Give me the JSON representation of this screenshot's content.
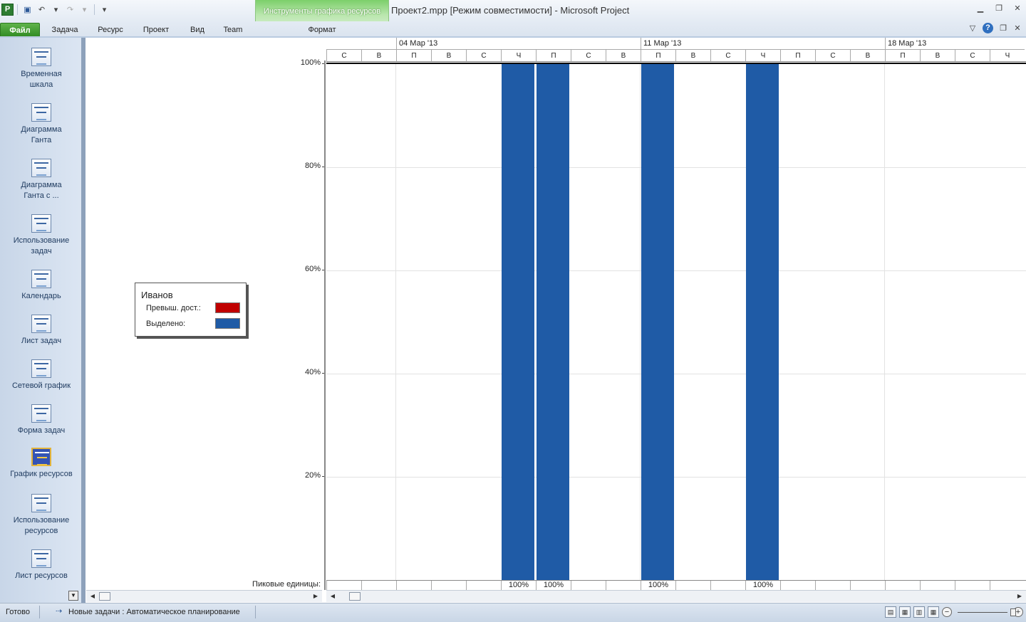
{
  "app": {
    "window_title": "Проект2.mpp [Режим совместимости]  -  Microsoft Project",
    "context_tab_group": "Инструменты графика ресурсов"
  },
  "ribbon": {
    "tabs": [
      {
        "label": "Файл",
        "active": true
      },
      {
        "label": "Задача"
      },
      {
        "label": "Ресурс"
      },
      {
        "label": "Проект"
      },
      {
        "label": "Вид"
      },
      {
        "label": "Team"
      },
      {
        "label": "Формат"
      }
    ]
  },
  "view_bar": {
    "items": [
      {
        "label": "Временная шкала",
        "icon": "timeline-icon"
      },
      {
        "label": "Диаграмма Ганта",
        "icon": "gantt-icon"
      },
      {
        "label": "Диаграмма Ганта с ...",
        "icon": "tracking-gantt-icon"
      },
      {
        "label": "Использование задач",
        "icon": "task-usage-icon"
      },
      {
        "label": "Календарь",
        "icon": "calendar-icon"
      },
      {
        "label": "Лист задач",
        "icon": "task-sheet-icon"
      },
      {
        "label": "Сетевой график",
        "icon": "network-icon"
      },
      {
        "label": "Форма задач",
        "icon": "task-form-icon"
      },
      {
        "label": "График ресурсов",
        "icon": "resource-graph-icon",
        "active": true
      },
      {
        "label": "Использование ресурсов",
        "icon": "resource-usage-icon"
      },
      {
        "label": "Лист ресурсов",
        "icon": "resource-sheet-icon"
      }
    ]
  },
  "legend": {
    "resource_name": "Иванов",
    "overallocated_label": "Превыш. дост.:",
    "allocated_label": "Выделено:",
    "overallocated_color": "#c00000",
    "allocated_color": "#1f5ba6"
  },
  "peak_units_label": "Пиковые единицы:",
  "timescale": {
    "weeks": [
      "04 Мар '13",
      "11 Мар '13",
      "18 Мар '13"
    ],
    "days": [
      "С",
      "В",
      "П",
      "В",
      "С",
      "Ч",
      "П",
      "С",
      "В",
      "П",
      "В",
      "С",
      "Ч",
      "П",
      "С",
      "В",
      "П",
      "В",
      "С",
      "Ч"
    ]
  },
  "chart_data": {
    "type": "bar",
    "ylim": [
      0,
      100
    ],
    "y_ticks": [
      "100%",
      "80%",
      "60%",
      "40%",
      "20%"
    ],
    "categories": [
      "С",
      "В",
      "П",
      "В",
      "С",
      "Ч",
      "П",
      "С",
      "В",
      "П",
      "В",
      "С",
      "Ч",
      "П",
      "С",
      "В",
      "П",
      "В",
      "С",
      "Ч"
    ],
    "series": [
      {
        "name": "Выделено",
        "values": [
          0,
          0,
          0,
          0,
          0,
          100,
          100,
          0,
          0,
          100,
          0,
          0,
          100,
          0,
          0,
          0,
          0,
          0,
          0,
          0
        ]
      }
    ],
    "peak_units": [
      "",
      "",
      "",
      "",
      "",
      "100%",
      "100%",
      "",
      "",
      "100%",
      "",
      "",
      "100%",
      "",
      "",
      "",
      "",
      "",
      "",
      ""
    ]
  },
  "status": {
    "ready": "Готово",
    "new_tasks": "Новые задачи : Автоматическое планирование"
  }
}
